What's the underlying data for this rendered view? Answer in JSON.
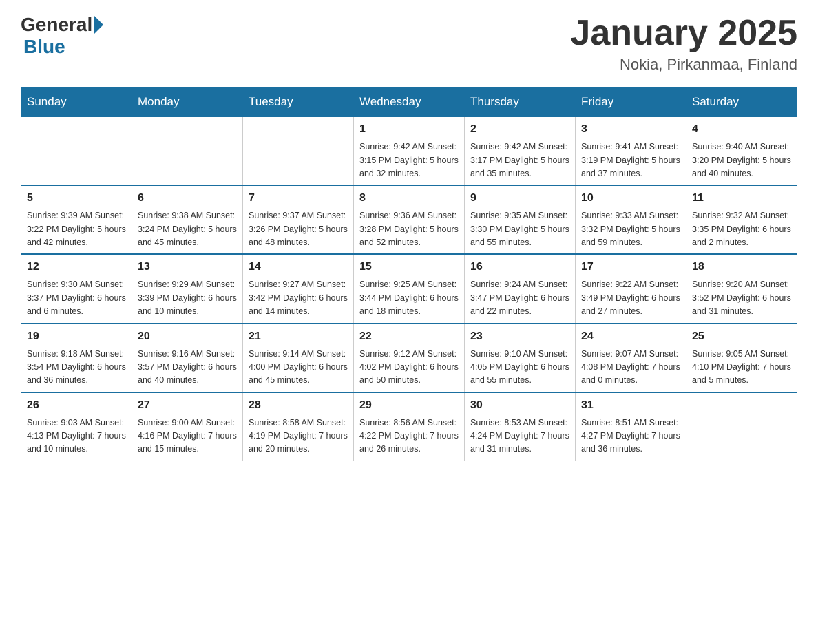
{
  "header": {
    "logo_general": "General",
    "logo_blue": "Blue",
    "month_title": "January 2025",
    "location": "Nokia, Pirkanmaa, Finland"
  },
  "days_of_week": [
    "Sunday",
    "Monday",
    "Tuesday",
    "Wednesday",
    "Thursday",
    "Friday",
    "Saturday"
  ],
  "weeks": [
    [
      {
        "day": "",
        "info": ""
      },
      {
        "day": "",
        "info": ""
      },
      {
        "day": "",
        "info": ""
      },
      {
        "day": "1",
        "info": "Sunrise: 9:42 AM\nSunset: 3:15 PM\nDaylight: 5 hours\nand 32 minutes."
      },
      {
        "day": "2",
        "info": "Sunrise: 9:42 AM\nSunset: 3:17 PM\nDaylight: 5 hours\nand 35 minutes."
      },
      {
        "day": "3",
        "info": "Sunrise: 9:41 AM\nSunset: 3:19 PM\nDaylight: 5 hours\nand 37 minutes."
      },
      {
        "day": "4",
        "info": "Sunrise: 9:40 AM\nSunset: 3:20 PM\nDaylight: 5 hours\nand 40 minutes."
      }
    ],
    [
      {
        "day": "5",
        "info": "Sunrise: 9:39 AM\nSunset: 3:22 PM\nDaylight: 5 hours\nand 42 minutes."
      },
      {
        "day": "6",
        "info": "Sunrise: 9:38 AM\nSunset: 3:24 PM\nDaylight: 5 hours\nand 45 minutes."
      },
      {
        "day": "7",
        "info": "Sunrise: 9:37 AM\nSunset: 3:26 PM\nDaylight: 5 hours\nand 48 minutes."
      },
      {
        "day": "8",
        "info": "Sunrise: 9:36 AM\nSunset: 3:28 PM\nDaylight: 5 hours\nand 52 minutes."
      },
      {
        "day": "9",
        "info": "Sunrise: 9:35 AM\nSunset: 3:30 PM\nDaylight: 5 hours\nand 55 minutes."
      },
      {
        "day": "10",
        "info": "Sunrise: 9:33 AM\nSunset: 3:32 PM\nDaylight: 5 hours\nand 59 minutes."
      },
      {
        "day": "11",
        "info": "Sunrise: 9:32 AM\nSunset: 3:35 PM\nDaylight: 6 hours\nand 2 minutes."
      }
    ],
    [
      {
        "day": "12",
        "info": "Sunrise: 9:30 AM\nSunset: 3:37 PM\nDaylight: 6 hours\nand 6 minutes."
      },
      {
        "day": "13",
        "info": "Sunrise: 9:29 AM\nSunset: 3:39 PM\nDaylight: 6 hours\nand 10 minutes."
      },
      {
        "day": "14",
        "info": "Sunrise: 9:27 AM\nSunset: 3:42 PM\nDaylight: 6 hours\nand 14 minutes."
      },
      {
        "day": "15",
        "info": "Sunrise: 9:25 AM\nSunset: 3:44 PM\nDaylight: 6 hours\nand 18 minutes."
      },
      {
        "day": "16",
        "info": "Sunrise: 9:24 AM\nSunset: 3:47 PM\nDaylight: 6 hours\nand 22 minutes."
      },
      {
        "day": "17",
        "info": "Sunrise: 9:22 AM\nSunset: 3:49 PM\nDaylight: 6 hours\nand 27 minutes."
      },
      {
        "day": "18",
        "info": "Sunrise: 9:20 AM\nSunset: 3:52 PM\nDaylight: 6 hours\nand 31 minutes."
      }
    ],
    [
      {
        "day": "19",
        "info": "Sunrise: 9:18 AM\nSunset: 3:54 PM\nDaylight: 6 hours\nand 36 minutes."
      },
      {
        "day": "20",
        "info": "Sunrise: 9:16 AM\nSunset: 3:57 PM\nDaylight: 6 hours\nand 40 minutes."
      },
      {
        "day": "21",
        "info": "Sunrise: 9:14 AM\nSunset: 4:00 PM\nDaylight: 6 hours\nand 45 minutes."
      },
      {
        "day": "22",
        "info": "Sunrise: 9:12 AM\nSunset: 4:02 PM\nDaylight: 6 hours\nand 50 minutes."
      },
      {
        "day": "23",
        "info": "Sunrise: 9:10 AM\nSunset: 4:05 PM\nDaylight: 6 hours\nand 55 minutes."
      },
      {
        "day": "24",
        "info": "Sunrise: 9:07 AM\nSunset: 4:08 PM\nDaylight: 7 hours\nand 0 minutes."
      },
      {
        "day": "25",
        "info": "Sunrise: 9:05 AM\nSunset: 4:10 PM\nDaylight: 7 hours\nand 5 minutes."
      }
    ],
    [
      {
        "day": "26",
        "info": "Sunrise: 9:03 AM\nSunset: 4:13 PM\nDaylight: 7 hours\nand 10 minutes."
      },
      {
        "day": "27",
        "info": "Sunrise: 9:00 AM\nSunset: 4:16 PM\nDaylight: 7 hours\nand 15 minutes."
      },
      {
        "day": "28",
        "info": "Sunrise: 8:58 AM\nSunset: 4:19 PM\nDaylight: 7 hours\nand 20 minutes."
      },
      {
        "day": "29",
        "info": "Sunrise: 8:56 AM\nSunset: 4:22 PM\nDaylight: 7 hours\nand 26 minutes."
      },
      {
        "day": "30",
        "info": "Sunrise: 8:53 AM\nSunset: 4:24 PM\nDaylight: 7 hours\nand 31 minutes."
      },
      {
        "day": "31",
        "info": "Sunrise: 8:51 AM\nSunset: 4:27 PM\nDaylight: 7 hours\nand 36 minutes."
      },
      {
        "day": "",
        "info": ""
      }
    ]
  ]
}
